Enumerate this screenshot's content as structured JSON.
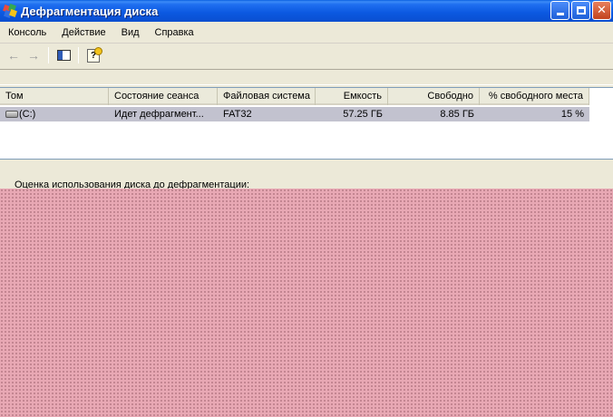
{
  "window": {
    "title": "Дефрагментация диска"
  },
  "menu": [
    "Консоль",
    "Действие",
    "Вид",
    "Справка"
  ],
  "toolbar": {
    "back": "←",
    "forward": "→",
    "help_glyph": "?"
  },
  "table": {
    "columns": [
      "Том",
      "Состояние сеанса",
      "Файловая система",
      "Емкость",
      "Свободно",
      "% свободного места"
    ],
    "rows": [
      {
        "volume": "(C:)",
        "status": "Идет дефрагмент...",
        "fs": "FAT32",
        "capacity": "57.25 ГБ",
        "free": "8.85 ГБ",
        "free_pct": "15 %"
      }
    ]
  },
  "analysis": {
    "label": "Оценка использования диска до дефрагментации:",
    "bar_colors": [
      "#e02020",
      "#2030d0",
      "#ffffff"
    ]
  }
}
